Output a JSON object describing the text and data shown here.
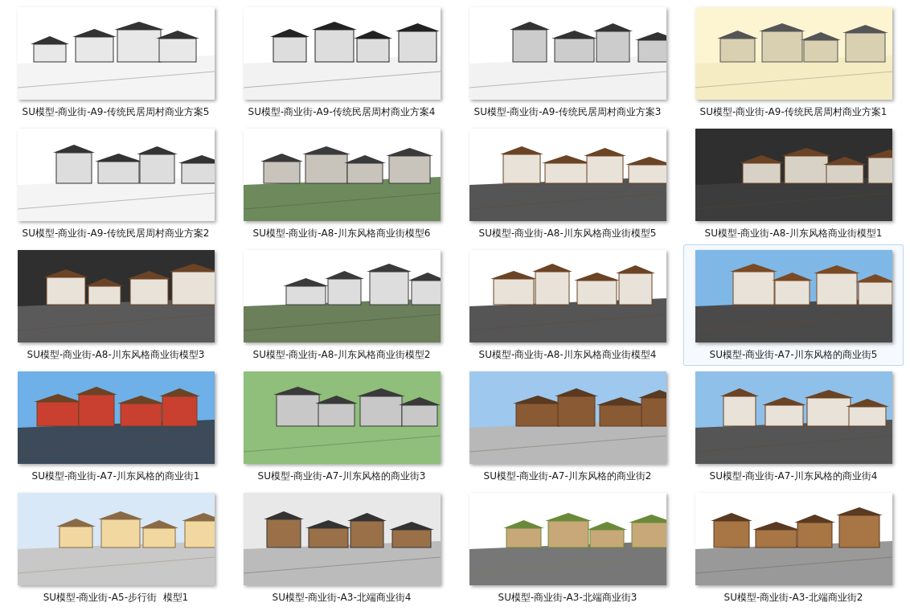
{
  "items": [
    {
      "label": "SU模型-商业街-A9-传统民居周村商业方案5",
      "selected": false
    },
    {
      "label": "SU模型-商业街-A9-传统民居周村商业方案4",
      "selected": false
    },
    {
      "label": "SU模型-商业街-A9-传统民居周村商业方案3",
      "selected": false
    },
    {
      "label": "SU模型-商业街-A9-传统民居周村商业方案1",
      "selected": false
    },
    {
      "label": "SU模型-商业街-A9-传统民居周村商业方案2",
      "selected": false
    },
    {
      "label": "SU模型-商业街-A8-川东风格商业街模型6",
      "selected": false
    },
    {
      "label": "SU模型-商业街-A8-川东风格商业街模型5",
      "selected": false
    },
    {
      "label": "SU模型-商业街-A8-川东风格商业街模型1",
      "selected": false
    },
    {
      "label": "SU模型-商业街-A8-川东风格商业街模型3",
      "selected": false
    },
    {
      "label": "SU模型-商业街-A8-川东风格商业街模型2",
      "selected": false
    },
    {
      "label": "SU模型-商业街-A8-川东风格商业街模型4",
      "selected": false
    },
    {
      "label": "SU模型-商业街-A7-川东风格的商业街5",
      "selected": true
    },
    {
      "label": "SU模型-商业街-A7-川东风格的商业街1",
      "selected": false
    },
    {
      "label": "SU模型-商业街-A7-川东风格的商业街3",
      "selected": false
    },
    {
      "label": "SU模型-商业街-A7-川东风格的商业街2",
      "selected": false
    },
    {
      "label": "SU模型-商业街-A7-川东风格的商业街4",
      "selected": false
    },
    {
      "label": "SU模型-商业街-A5-步行街  模型1",
      "selected": false
    },
    {
      "label": "SU模型-商业街-A3-北端商业街4",
      "selected": false
    },
    {
      "label": "SU模型-商业街-A3-北端商业街3",
      "selected": false
    },
    {
      "label": "SU模型-商业街-A3-北端商业街2",
      "selected": false
    }
  ]
}
